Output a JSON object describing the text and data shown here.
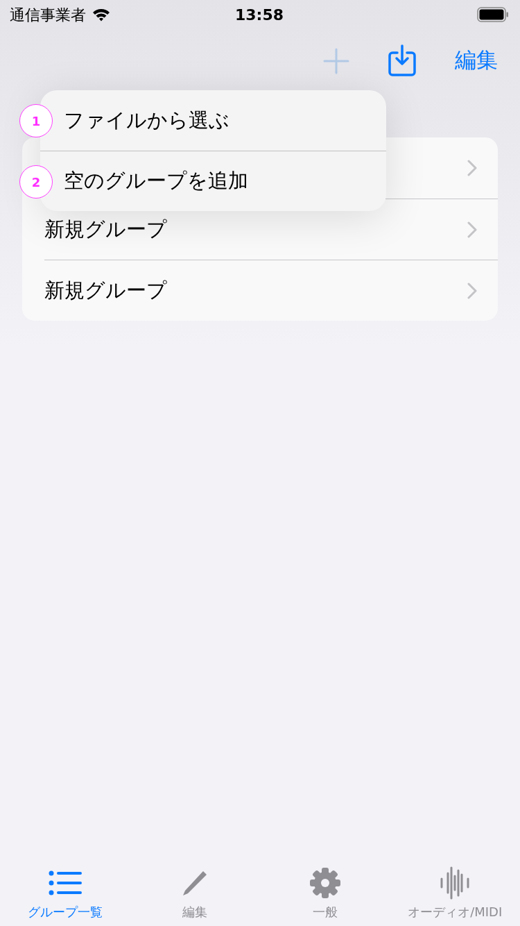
{
  "status_bar": {
    "carrier": "通信事業者",
    "time": "13:58"
  },
  "nav_bar": {
    "add_button": {
      "disabled": true
    },
    "edit_button": "編集"
  },
  "list": {
    "rows": [
      {
        "kind": "covered"
      },
      {
        "kind": "group",
        "title": "新規グループ"
      },
      {
        "kind": "group",
        "title": "新規グループ"
      }
    ]
  },
  "menu": {
    "items": [
      {
        "label": "ファイルから選ぶ",
        "marker": "1"
      },
      {
        "label": "空のグループを追加",
        "marker": "2"
      }
    ]
  },
  "tab_bar": {
    "tabs": [
      {
        "label": "グループ一覧",
        "selected": true
      },
      {
        "label": "編集",
        "selected": false
      },
      {
        "label": "一般",
        "selected": false
      },
      {
        "label": "オーディオ/MIDI",
        "selected": false
      }
    ]
  }
}
